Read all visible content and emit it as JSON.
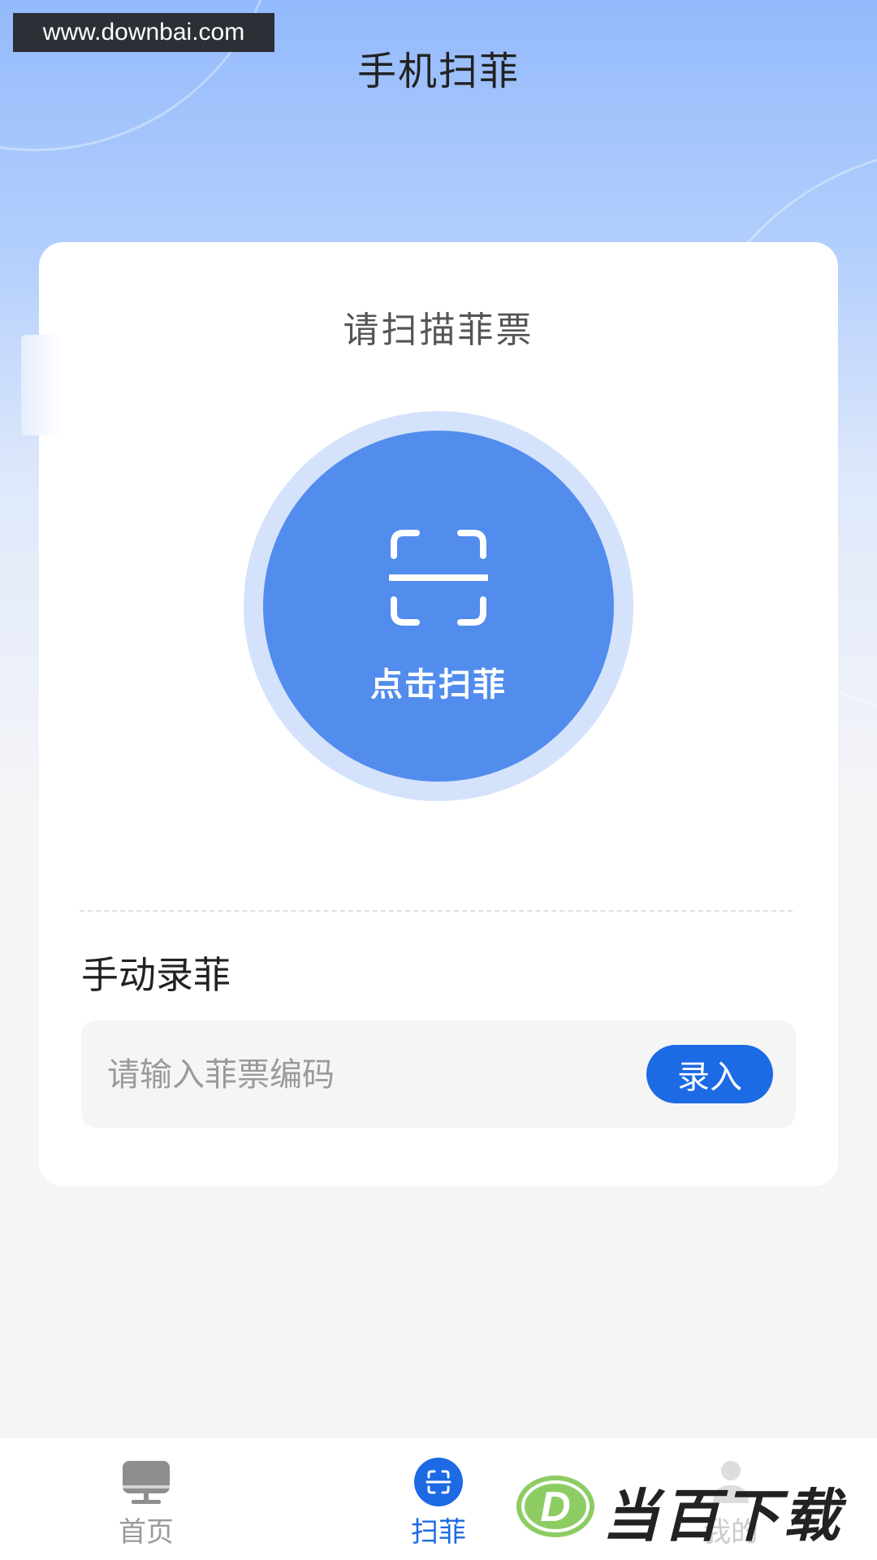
{
  "watermark": {
    "url": "www.downbai.com"
  },
  "header": {
    "title": "手机扫菲"
  },
  "scan": {
    "hint": "请扫描菲票",
    "button_label": "点击扫菲"
  },
  "manual": {
    "title": "手动录菲",
    "input_placeholder": "请输入菲票编码",
    "input_value": "",
    "submit_label": "录入"
  },
  "tabbar": {
    "items": [
      {
        "label": "首页",
        "icon": "monitor-icon",
        "active": false
      },
      {
        "label": "扫菲",
        "icon": "scan-icon",
        "active": true
      },
      {
        "label": "我的",
        "icon": "user-icon",
        "active": false
      }
    ]
  },
  "brand": {
    "text": "当百下载",
    "letter": "D"
  },
  "colors": {
    "primary": "#1c6ae4",
    "scan_button": "#528ced",
    "scan_ring": "#d4e3fb",
    "header_gradient_top": "#93bafc",
    "page_background": "#f5f5f7"
  }
}
